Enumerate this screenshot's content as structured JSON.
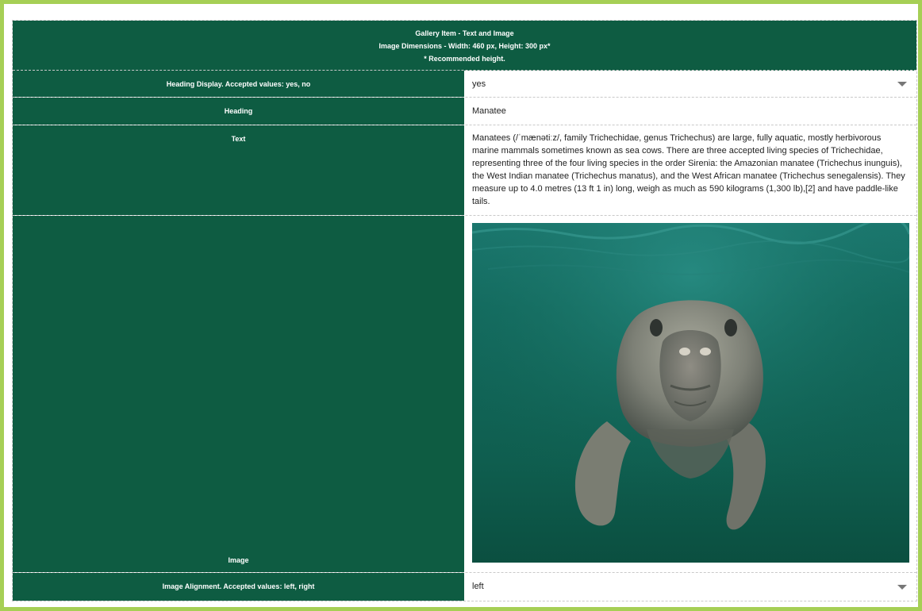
{
  "header": {
    "line1": "Gallery Item - Text and Image",
    "line2": "Image Dimensions - Width: 460 px, Height: 300 px*",
    "line3": "* Recommended height."
  },
  "fields": {
    "heading_display": {
      "label": "Heading Display. Accepted values: yes, no",
      "value": "yes"
    },
    "heading": {
      "label": "Heading",
      "value": "Manatee"
    },
    "text": {
      "label": "Text",
      "value": "Manatees (/ˈmænətiːz/, family Trichechidae, genus Trichechus) are large, fully aquatic, mostly herbivorous marine mammals sometimes known as sea cows. There are three accepted living species of Trichechidae, representing three of the four living species in the order Sirenia: the Amazonian manatee (Trichechus inunguis), the West Indian manatee (Trichechus manatus), and the West African manatee (Trichechus senegalensis). They measure up to 4.0 metres (13 ft 1 in) long, weigh as much as 590 kilograms (1,300 lb),[2] and have paddle-like tails."
    },
    "image": {
      "label": "Image"
    },
    "image_alignment": {
      "label": "Image Alignment. Accepted values: left, right",
      "value": "left"
    }
  },
  "colors": {
    "label_bg": "#0e5c42",
    "frame_border": "#a6cf55"
  }
}
